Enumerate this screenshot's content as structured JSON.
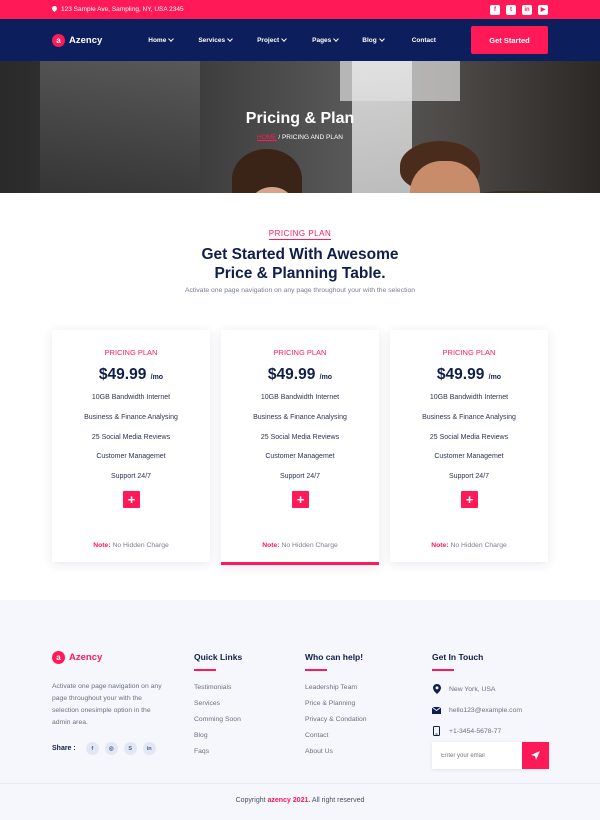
{
  "topbar": {
    "address": "123 Sample Ave, Sampling, NY, USA 2345",
    "socials": [
      {
        "icon": "facebook-icon",
        "glyph": "f"
      },
      {
        "icon": "twitter-icon",
        "glyph": "t"
      },
      {
        "icon": "linkedin-icon",
        "glyph": "in"
      },
      {
        "icon": "youtube-icon",
        "glyph": "▶"
      }
    ]
  },
  "nav": {
    "logo_mark": "a",
    "logo_text": "Azency",
    "menu": [
      "Home",
      "Services",
      "Project",
      "Pages",
      "Blog",
      "Contact"
    ],
    "cta": "Get Started"
  },
  "hero": {
    "title": "Pricing & Plan",
    "crumb_home": "HOME",
    "crumb_sep": " / ",
    "crumb_current": "PRICING AND PLAN"
  },
  "pricing": {
    "eyebrow": "PRICING PLAN",
    "title_line1": "Get Started With Awesome",
    "title_line2": "Price & Planning Table.",
    "description": "Activate one page navigation on any page throughout your with the selection",
    "cards": [
      {
        "title": "PRICING PLAN",
        "price": "$49.99",
        "period": "/mo",
        "features": [
          "10GB Bandwidth Internet",
          "Business & Finance Analysing",
          "25 Social Media Reviews",
          "Customer Managemet",
          "Support 24/7"
        ],
        "plus": "+",
        "note_label": "Note:",
        "note_text": " No Hidden Charge"
      },
      {
        "title": "PRICING PLAN",
        "price": "$49.99",
        "period": "/mo",
        "features": [
          "10GB Bandwidth Internet",
          "Business & Finance Analysing",
          "25 Social Media Reviews",
          "Customer Managemet",
          "Support 24/7"
        ],
        "plus": "+",
        "note_label": "Note:",
        "note_text": " No Hidden Charge"
      },
      {
        "title": "PRICING PLAN",
        "price": "$49.99",
        "period": "/mo",
        "features": [
          "10GB Bandwidth Internet",
          "Business & Finance Analysing",
          "25 Social Media Reviews",
          "Customer Managemet",
          "Support 24/7"
        ],
        "plus": "+",
        "note_label": "Note:",
        "note_text": " No Hidden Charge"
      }
    ]
  },
  "footer": {
    "logo_mark": "a",
    "logo_text": "Azency",
    "about": "Activate one page navigation on any page throughout your with the selection onesimple option in the admin area.",
    "share_label": "Share :",
    "share_icons": [
      {
        "icon": "facebook-icon",
        "glyph": "f"
      },
      {
        "icon": "dribbble-icon",
        "glyph": "◎"
      },
      {
        "icon": "skype-icon",
        "glyph": "S"
      },
      {
        "icon": "linkedin-icon",
        "glyph": "in"
      }
    ],
    "quick_links": {
      "title": "Quick Links",
      "items": [
        "Testimonials",
        "Services",
        "Comming Soon",
        "Blog",
        "Faqs"
      ]
    },
    "help": {
      "title": "Who can help!",
      "items": [
        "Leadership Team",
        "Price & Planning",
        "Privacy & Condation",
        "Contact",
        "About Us"
      ]
    },
    "contact": {
      "title": "Get In Touch",
      "location": "New York, USA",
      "email": "hello123@example.com",
      "phone": "+1-3454-5678-77"
    },
    "subscribe_placeholder": "Enter your email",
    "copyright_prefix": "Copyright ",
    "copyright_brand": "azency 2021.",
    "copyright_suffix": " All right reserved"
  },
  "colors": {
    "accent": "#ff1a57",
    "navy": "#0c1f5c",
    "footer_bg": "#f5f7fc"
  }
}
